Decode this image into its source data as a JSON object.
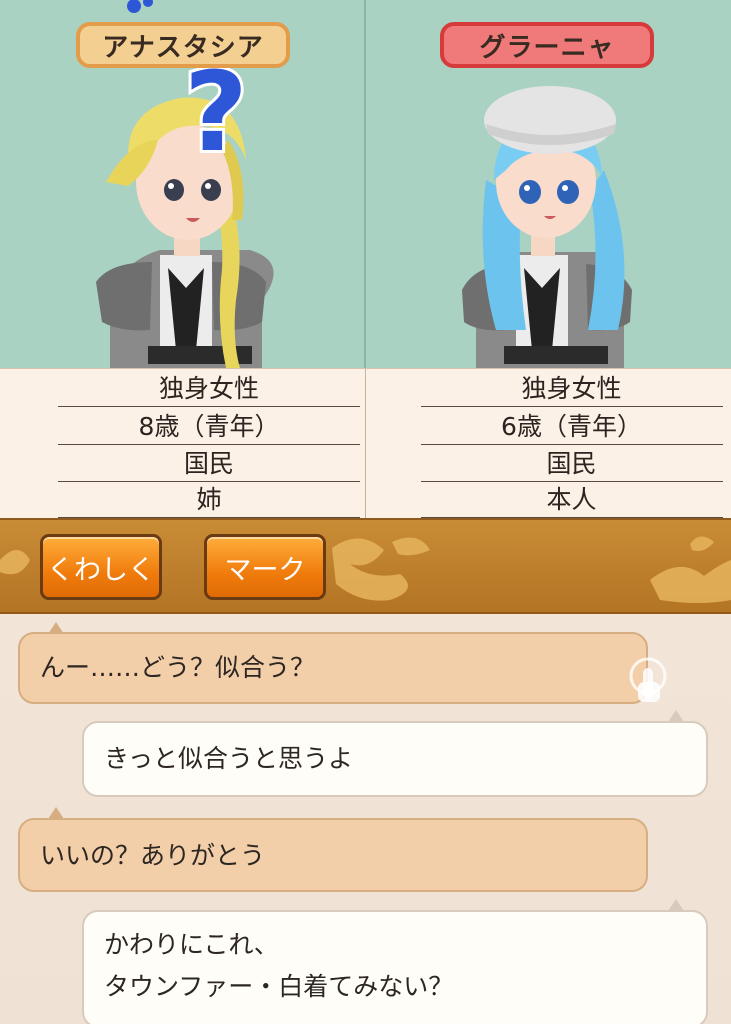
{
  "characters": [
    {
      "name": "アナスタシア",
      "info": [
        "独身女性",
        "8歳（青年）",
        "国民",
        "姉"
      ]
    },
    {
      "name": "グラーニャ",
      "info": [
        "独身女性",
        "6歳（青年）",
        "国民",
        "本人"
      ]
    }
  ],
  "actions": {
    "detail_label": "くわしく",
    "mark_label": "マーク"
  },
  "chat": [
    {
      "speaker": "partner",
      "text": "んー……どう？似合う？"
    },
    {
      "speaker": "me",
      "text": "きっと似合うと思うよ"
    },
    {
      "speaker": "partner",
      "text": "いいの？ありがとう"
    },
    {
      "speaker": "me",
      "line1": "かわりにこれ、",
      "line2": "タウンファー・白着てみない？"
    }
  ],
  "colors": {
    "portrait_bg": "#a9d2c3",
    "left_plate": "#f3cf92",
    "right_plate": "#f07a7a",
    "button_orange": "#f07c0c",
    "bar_brown": "#b37424"
  },
  "icons": {
    "question": "question-mark-icon",
    "tap": "tap-hand-icon"
  }
}
